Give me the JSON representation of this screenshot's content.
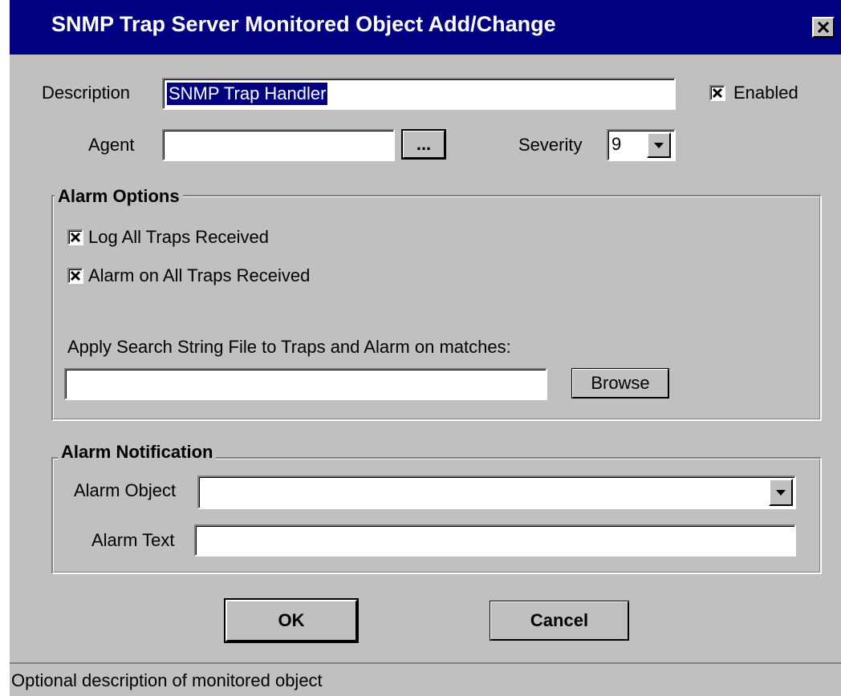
{
  "window": {
    "title": "SNMP Trap Server Monitored Object Add/Change"
  },
  "fields": {
    "description": {
      "label": "Description",
      "value": "SNMP Trap Handler"
    },
    "enabled": {
      "label": "Enabled",
      "checked": true
    },
    "agent": {
      "label": "Agent",
      "value": "",
      "browse_label": "..."
    },
    "severity": {
      "label": "Severity",
      "value": "9"
    }
  },
  "alarm_options": {
    "title": "Alarm Options",
    "log_all_traps": {
      "label": "Log All Traps Received",
      "checked": true
    },
    "alarm_all_traps": {
      "label": "Alarm on All Traps Received",
      "checked": true
    },
    "search_string_label": "Apply Search String File to Traps and Alarm on matches:",
    "search_string_value": "",
    "browse_label": "Browse"
  },
  "alarm_notification": {
    "title": "Alarm Notification",
    "alarm_object_label": "Alarm Object",
    "alarm_object_value": "",
    "alarm_text_label": "Alarm Text",
    "alarm_text_value": ""
  },
  "buttons": {
    "ok": "OK",
    "cancel": "Cancel"
  },
  "status_bar": {
    "text": "Optional description of monitored object"
  },
  "colors": {
    "titlebar": "#000080",
    "face": "#c0c0c0",
    "selection": "#000080"
  },
  "icons": {
    "close": "close-icon",
    "dropdown": "chevron-down-icon",
    "check": "check-x-icon"
  }
}
